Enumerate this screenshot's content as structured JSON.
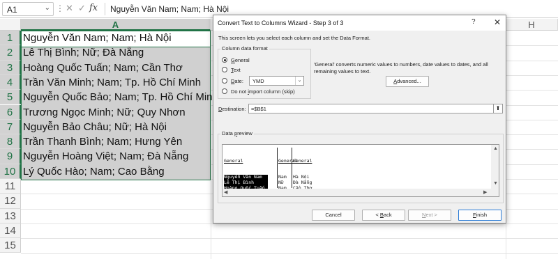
{
  "formula_bar": {
    "name_box": "A1",
    "name_box_arrow": "⌄",
    "more": "⋮",
    "cancel_glyph": "✕",
    "enter_glyph": "✓",
    "fx": "fx",
    "formula": "Nguyễn Văn Nam; Nam; Hà Nội"
  },
  "sheet": {
    "columns": [
      "A",
      "H"
    ],
    "row_numbers": [
      "1",
      "2",
      "3",
      "4",
      "5",
      "6",
      "7",
      "8",
      "9",
      "10",
      "11",
      "12",
      "13",
      "14",
      "15"
    ],
    "cells": [
      "Nguyễn Văn Nam; Nam; Hà Nội",
      "Lê Thị Bình; Nữ; Đà Nẵng",
      "Hoàng Quốc Tuấn; Nam; Cần Thơ",
      "Trần Văn Minh; Nam; Tp. Hồ Chí Minh",
      "Nguyễn Quốc Bảo; Nam; Tp. Hồ Chí Minh",
      "Trương Ngọc Minh; Nữ; Quy Nhơn",
      "Nguyễn Bảo Châu; Nữ; Hà Nội",
      "Trần Thanh Bình; Nam; Hưng Yên",
      "Nguyễn Hoàng Việt; Nam; Đà Nẵng",
      "Lý Quốc Hào; Nam; Cao Bằng"
    ],
    "selection_color": "#217346"
  },
  "dialog": {
    "title": "Convert Text to Columns Wizard - Step 3 of 3",
    "help": "?",
    "close": "✕",
    "intro": "This screen lets you select each column and set the Data Format.",
    "group_label": "Column data format",
    "options": {
      "general": "General",
      "text": "Text",
      "date": "Date:",
      "skip": "Do not import column (skip)"
    },
    "selected_option": "General",
    "date_format": "YMD",
    "date_arrow": "⌄",
    "description": "'General' converts numeric values to numbers, date values to dates, and all remaining values to text.",
    "advanced": "Advanced...",
    "destination_label": "Destination:",
    "destination_value": "=$B$1",
    "destination_icon": "⬆",
    "preview_label": "Data preview",
    "preview": {
      "headers": [
        "General",
        "General",
        "General"
      ],
      "col1": [
        "Nguyễn Văn Nam",
        "Lê Thị Bình",
        "Hoàng Quốc Tuấn",
        "Trần Văn Minh",
        "Nguyễn Quốc Bảo",
        "Trương Ngọc Minh"
      ],
      "col2": [
        "Nam",
        "Nữ",
        "Nam",
        "Nam",
        "Nam",
        "Nữ"
      ],
      "col3": [
        "Hà Nội",
        "Đà Nẵng",
        "Cần Thơ",
        "Tp. Hồ Chí Minh",
        "Tp. Hồ Chí Minh",
        "Quy Nhơn"
      ]
    },
    "scroll": {
      "up": "▲",
      "down": "▼",
      "left": "◀",
      "right": "▶"
    },
    "buttons": {
      "cancel": "Cancel",
      "back": "< Back",
      "next": "Next >",
      "finish": "Finish"
    }
  }
}
